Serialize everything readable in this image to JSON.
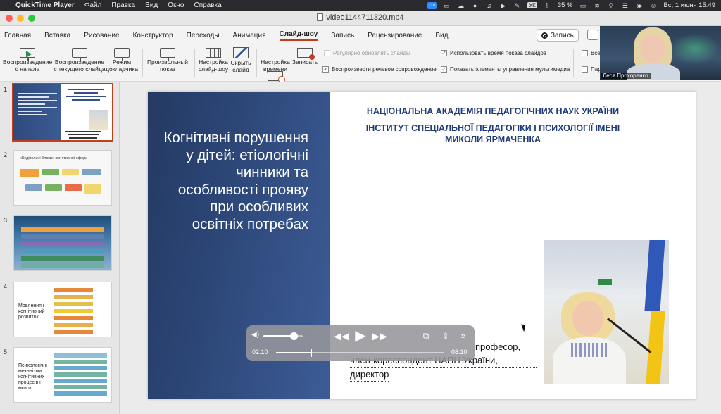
{
  "menubar": {
    "app_name": "QuickTime Player",
    "items": [
      "Файл",
      "Правка",
      "Вид",
      "Окно",
      "Справка"
    ],
    "status": {
      "zoom_badge": "zm",
      "lang": "УК",
      "battery": "35 %",
      "datetime": "Вс, 1 июня  15:49"
    }
  },
  "window": {
    "title": "video1144711320.mp4"
  },
  "ribbon": {
    "tabs": [
      "Главная",
      "Вставка",
      "Рисование",
      "Конструктор",
      "Переходы",
      "Анимация",
      "Слайд-шоу",
      "Запись",
      "Рецензирование",
      "Вид"
    ],
    "active_tab": "Слайд-шоу",
    "record_label": "Запись",
    "buttons": {
      "from_start": "Воспроизведение\nс начала",
      "from_current": "Воспроизведение\nс текущего слайда",
      "presenter": "Режим\nдокладчика",
      "custom": "Произвольный\nпоказ",
      "setup": "Настройка\nслайд-шоу",
      "hide": "Скрыть\nслайд",
      "rehearse": "Настройка\nвремени",
      "record": "Записать"
    },
    "checks": {
      "auto_update": "Регулярно обновлять слайды",
      "narration": "Воспроизвести речевое сопровождение",
      "timings": "Использовать время показа слайдов",
      "media_controls": "Показать элементы управления мультимедиа",
      "cut_all": "Все",
      "cut_par": "Пар"
    }
  },
  "thumbnails": {
    "numbers": [
      "1",
      "2",
      "3",
      "4",
      "5"
    ],
    "slide2_title": "«Будівельні блоки» когнітивної сфери",
    "slide4_title": "Мовлення і когнітивний розвиток",
    "slide5_title": "Психологічні механізми когнітивних процесів і мозок"
  },
  "slide": {
    "title": "Когнітивні порушення у дітей: етіологічні чинники та особливості прояву при особливих освітніх потребах",
    "org_line1": "НАЦІОНАЛЬНА АКАДЕМІЯ ПЕДАГОГІЧНИХ НАУК УКРАЇНИ",
    "org_line2": "ІНСТИТУТ СПЕЦІАЛЬНОЇ ПЕДАГОГІКИ І ПСИХОЛОГІЇ ІМЕНІ МИКОЛИ ЯРМАЧЕНКА",
    "bottom_line1": "професор,",
    "bottom_line2": "член-кореспондент НАПН України,",
    "bottom_line3": "директор"
  },
  "player": {
    "elapsed": "02:10",
    "remaining": "08:10",
    "progress": 0.21,
    "volume": 0.76
  },
  "webcam": {
    "name": "Леся Прохоренко"
  }
}
